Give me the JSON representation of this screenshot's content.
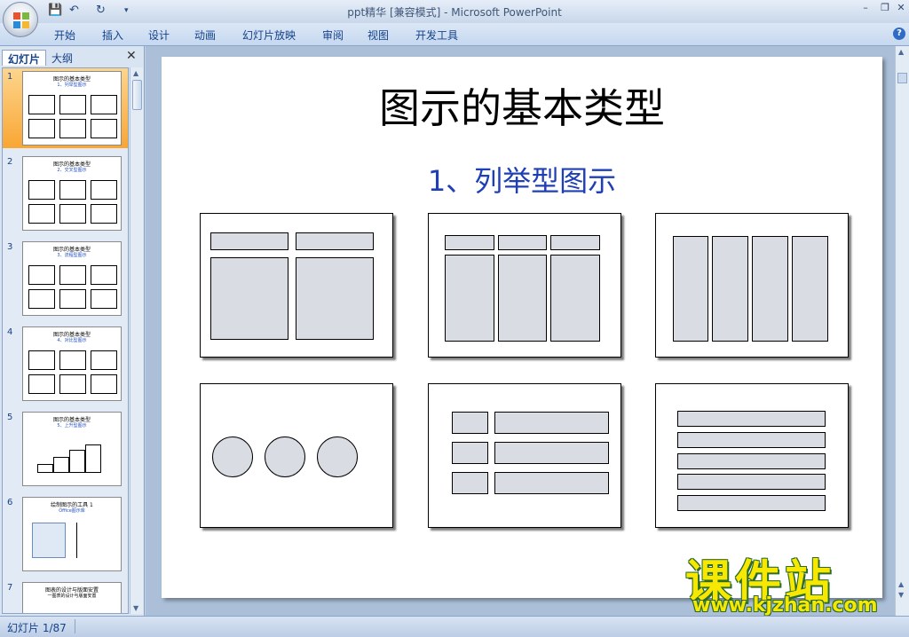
{
  "window": {
    "title_doc": "ppt精华 [兼容模式] - ",
    "title_app": "Microsoft PowerPoint",
    "controls": [
      "–",
      "❐",
      "✕"
    ]
  },
  "quick_access": {
    "save": "💾",
    "undo": "↶",
    "redo": "↻",
    "more": "▾"
  },
  "ribbon_tabs": [
    "开始",
    "插入",
    "设计",
    "动画",
    "幻灯片放映",
    "审阅",
    "视图",
    "开发工具"
  ],
  "panel": {
    "tab_slides": "幻灯片",
    "tab_outline": "大纲",
    "close": "✕"
  },
  "thumbnails": [
    {
      "num": "1",
      "title": "图示的基本类型",
      "sub": "1、列举型图示"
    },
    {
      "num": "2",
      "title": "图示的基本类型",
      "sub": "2、交叉型图示"
    },
    {
      "num": "3",
      "title": "图示的基本类型",
      "sub": "3、流程型图示"
    },
    {
      "num": "4",
      "title": "图示的基本类型",
      "sub": "4、对比型图示"
    },
    {
      "num": "5",
      "title": "图示的基本类型",
      "sub": "5、上升型图示"
    },
    {
      "num": "6",
      "title": "绘制图示的工具 1",
      "sub": "Office图示库"
    },
    {
      "num": "7",
      "title": "图表的设计与版面安置",
      "sub": "一图表的设计与版面安置"
    }
  ],
  "slide": {
    "title": "图示的基本类型",
    "subtitle": "1、列举型图示"
  },
  "status": {
    "slide_counter": "幻灯片 1/87"
  },
  "watermark": {
    "cn": "课件站",
    "url": "www.kjzhan.com"
  },
  "colors": {
    "accent": "#1e3fb5",
    "selection": "#f9a633",
    "shape_fill": "#d9dde3"
  }
}
